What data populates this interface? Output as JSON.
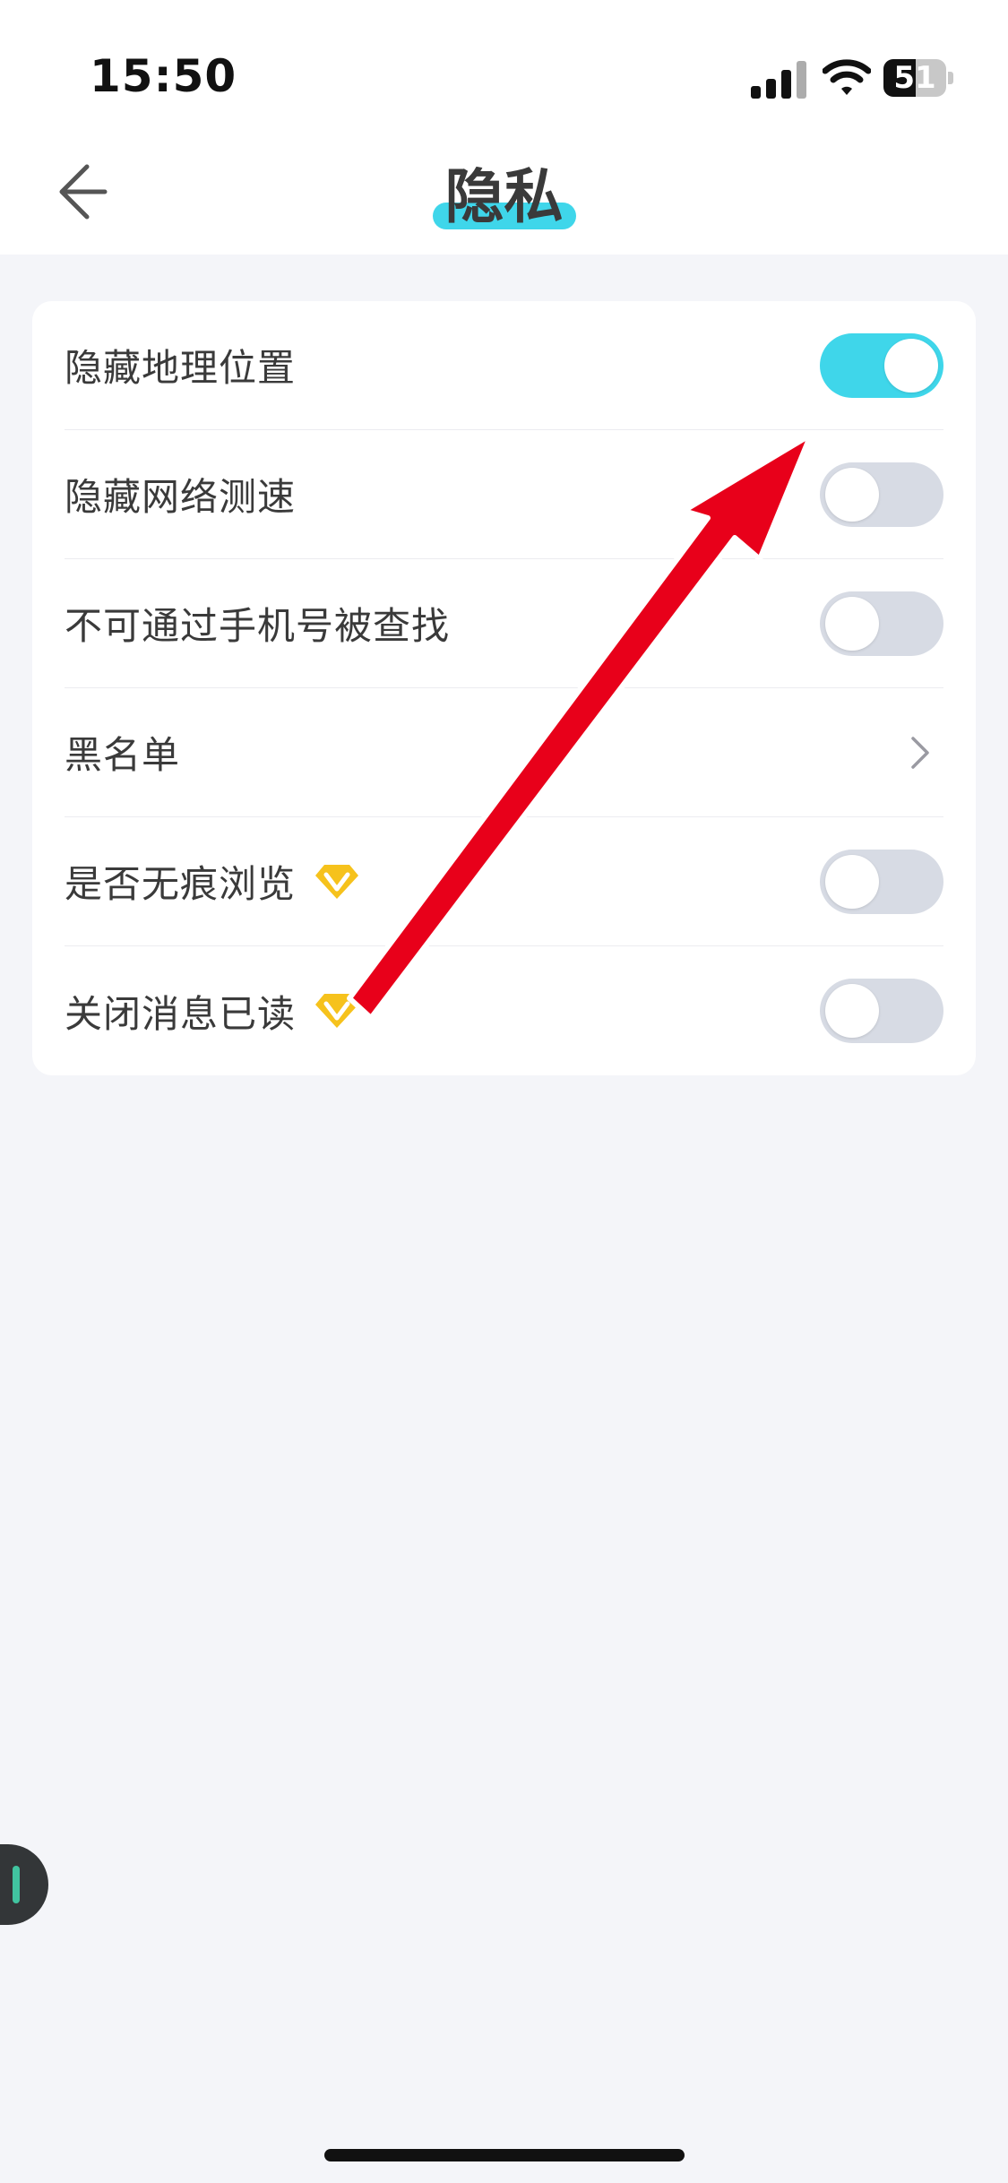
{
  "status_bar": {
    "time": "15:50",
    "battery_percent": 51,
    "battery_label": "51"
  },
  "header": {
    "title": "隐私",
    "back_icon": "arrow-left-icon",
    "accent_color": "#3fd6ea"
  },
  "settings": {
    "items": [
      {
        "label": "隐藏地理位置",
        "control": "toggle",
        "enabled": true,
        "vip": false
      },
      {
        "label": "隐藏网络测速",
        "control": "toggle",
        "enabled": false,
        "vip": false
      },
      {
        "label": "不可通过手机号被查找",
        "control": "toggle",
        "enabled": false,
        "vip": false
      },
      {
        "label": "黑名单",
        "control": "chevron",
        "vip": false
      },
      {
        "label": "是否无痕浏览",
        "control": "toggle",
        "enabled": false,
        "vip": true
      },
      {
        "label": "关闭消息已读",
        "control": "toggle",
        "enabled": false,
        "vip": true
      }
    ]
  },
  "colors": {
    "toggle_on": "#3fd6ea",
    "toggle_off": "#d7dbe4",
    "vip_badge": "#f6c21c",
    "annotation_arrow": "#e8001a"
  }
}
